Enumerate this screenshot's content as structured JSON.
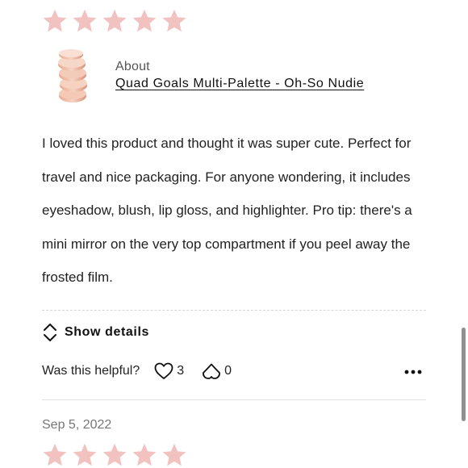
{
  "review": {
    "rating": 5,
    "rating_max": 5,
    "star_color": "#f2c2c0",
    "product": {
      "about_label": "About",
      "name": "Quad Goals Multi-Palette - Oh-So Nudie",
      "thumbnail_icon": "stacked-compact-palette-icon"
    },
    "text": "I loved this product and thought it was super cute. Perfect for travel and nice packaging. For anyone wondering, it includes eyeshadow, blush, lip gloss, and highlighter. Pro tip: there's a mini mirror on the very top compartment if you peel away the frosted film.",
    "show_details_label": "Show details",
    "helpful_label": "Was this helpful?",
    "helpful_yes_count": "3",
    "helpful_no_count": "0"
  },
  "next_review": {
    "date": "Sep 5, 2022",
    "rating": 5,
    "rating_max": 5
  }
}
